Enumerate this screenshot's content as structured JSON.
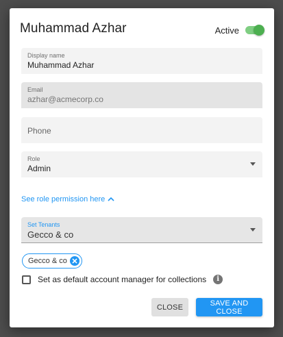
{
  "dialog": {
    "title": "Muhammad Azhar",
    "status_label": "Active",
    "status_on": true
  },
  "fields": {
    "display_name": {
      "label": "Display name",
      "value": "Muhammad Azhar"
    },
    "email": {
      "label": "Email",
      "value": "azhar@acmecorp.co"
    },
    "phone": {
      "placeholder": "Phone"
    },
    "role": {
      "label": "Role",
      "value": "Admin"
    }
  },
  "role_link": {
    "text": "See role permission here"
  },
  "tenants": {
    "label": "Set Tenants",
    "value": "Gecco & co",
    "chips": [
      "Gecco & co"
    ]
  },
  "default_manager": {
    "label": "Set as default account manager for collections",
    "checked": false
  },
  "actions": {
    "close_label": "CLOSE",
    "save_label": "SAVE AND CLOSE"
  },
  "colors": {
    "accent": "#2196f3",
    "toggle_on": "#4caf50",
    "backdrop": "#4d4d4d"
  }
}
